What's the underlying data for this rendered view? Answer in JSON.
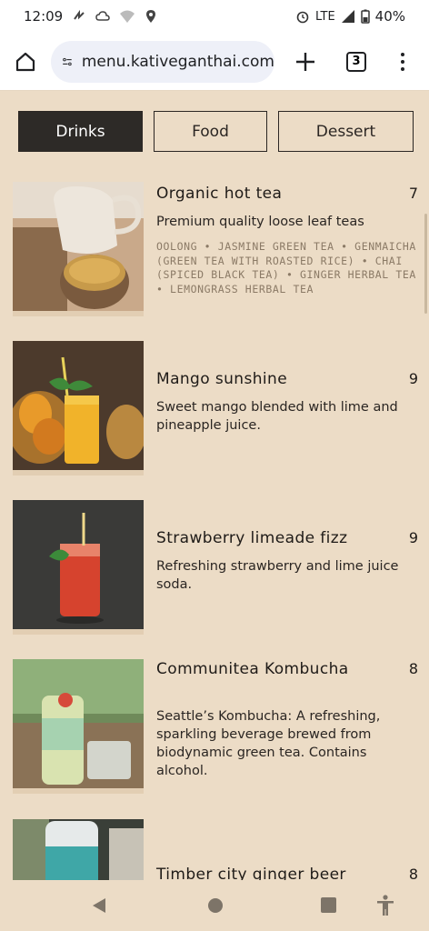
{
  "status": {
    "time": "12:09",
    "network": "LTE",
    "battery": "40%"
  },
  "browser": {
    "url": "menu.kativeganthai.com",
    "tab_count": "3"
  },
  "categories": [
    {
      "label": "Drinks",
      "active": true
    },
    {
      "label": "Food",
      "active": false
    },
    {
      "label": "Dessert",
      "active": false
    }
  ],
  "items": [
    {
      "name": "Organic hot tea",
      "price": "7",
      "description": "Premium quality loose leaf teas",
      "tags": "OOLONG • JASMINE GREEN TEA • GENMAICHA (GREEN TEA WITH ROASTED RICE) • CHAI (SPICED BLACK TEA) • GINGER HERBAL TEA • LEMONGRASS HERBAL TEA"
    },
    {
      "name": "Mango sunshine",
      "price": "9",
      "description": "Sweet mango blended with lime and pineapple juice."
    },
    {
      "name": "Strawberry limeade fizz",
      "price": "9",
      "description": "Refreshing strawberry and lime juice soda."
    },
    {
      "name": "Communitea Kombucha",
      "price": "8",
      "description": "Seattle’s Kombucha: A refreshing, sparkling beverage brewed from biodynamic green tea. Contains alcohol."
    },
    {
      "name": "Timber city ginger beer",
      "price": "8"
    }
  ],
  "icons": {
    "home": "home-icon",
    "site_settings": "site-settings-icon",
    "new_tab": "plus-icon",
    "tabs": "tab-switcher-icon",
    "menu": "more-vert-icon",
    "back": "back-triangle-icon",
    "home_nav": "home-circle-icon",
    "recents": "recents-square-icon",
    "accessibility": "accessibility-icon"
  }
}
